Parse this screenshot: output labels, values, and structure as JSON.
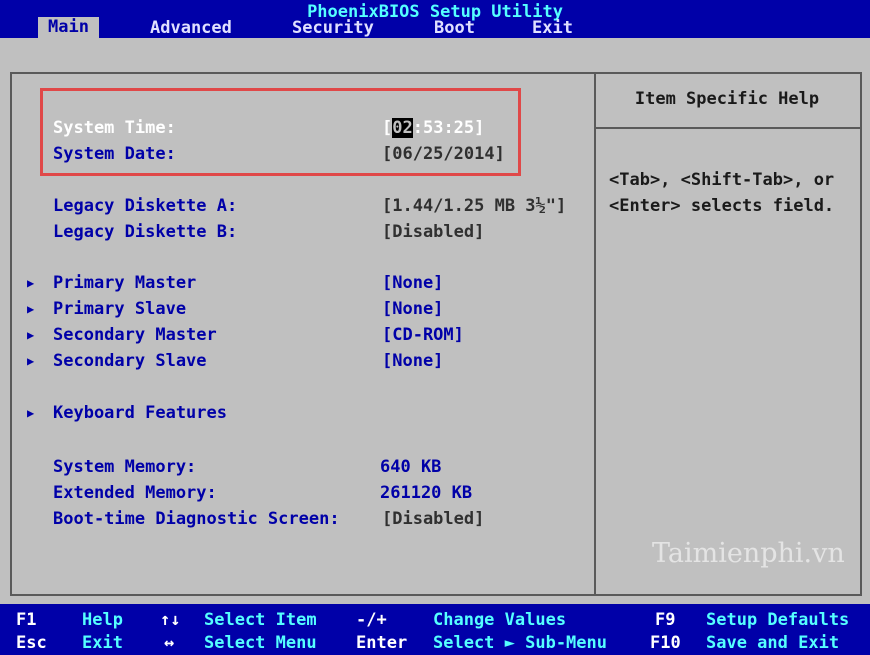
{
  "app": {
    "title": "PhoenixBIOS Setup Utility"
  },
  "menu": [
    {
      "label": "Main"
    },
    {
      "label": "Advanced"
    },
    {
      "label": "Security"
    },
    {
      "label": "Boot"
    },
    {
      "label": "Exit"
    }
  ],
  "fields": {
    "system_time_label": "System Time:",
    "system_time_open": "[",
    "system_time_cursor": "02",
    "system_time_rest": ":53:25]",
    "system_date_label": "System Date:",
    "system_date_value": "[06/25/2014]",
    "diskette_a_label": "Legacy Diskette A:",
    "diskette_a_value": "[1.44/1.25 MB  3½\"]",
    "diskette_b_label": "Legacy Diskette B:",
    "diskette_b_value": "[Disabled]",
    "primary_master_label": "Primary Master",
    "primary_master_value": "[None]",
    "primary_slave_label": "Primary Slave",
    "primary_slave_value": "[None]",
    "secondary_master_label": "Secondary Master",
    "secondary_master_value": "[CD-ROM]",
    "secondary_slave_label": "Secondary Slave",
    "secondary_slave_value": "[None]",
    "keyboard_label": "Keyboard Features",
    "system_memory_label": "System Memory:",
    "system_memory_value": "640 KB",
    "extended_memory_label": "Extended Memory:",
    "extended_memory_value": "261120 KB",
    "boot_diag_label": "Boot-time Diagnostic Screen:",
    "boot_diag_value": "[Disabled]"
  },
  "help": {
    "title": "Item Specific Help",
    "line1": "<Tab>, <Shift-Tab>, or",
    "line2": "<Enter> selects field."
  },
  "watermark": "Taimienphi.vn",
  "footer": {
    "f1_key": "F1",
    "f1_desc": "Help",
    "updown_key": "↑↓",
    "updown_desc": "Select Item",
    "minusplus_key": "-/+",
    "minusplus_desc": "Change Values",
    "f9_key": "F9",
    "f9_desc": "Setup Defaults",
    "esc_key": "Esc",
    "esc_desc": "Exit",
    "leftright_key": "↔",
    "leftright_desc": "Select Menu",
    "enter_key": "Enter",
    "enter_desc": "Select ► Sub-Menu",
    "f10_key": "F10",
    "f10_desc": "Save and Exit"
  }
}
